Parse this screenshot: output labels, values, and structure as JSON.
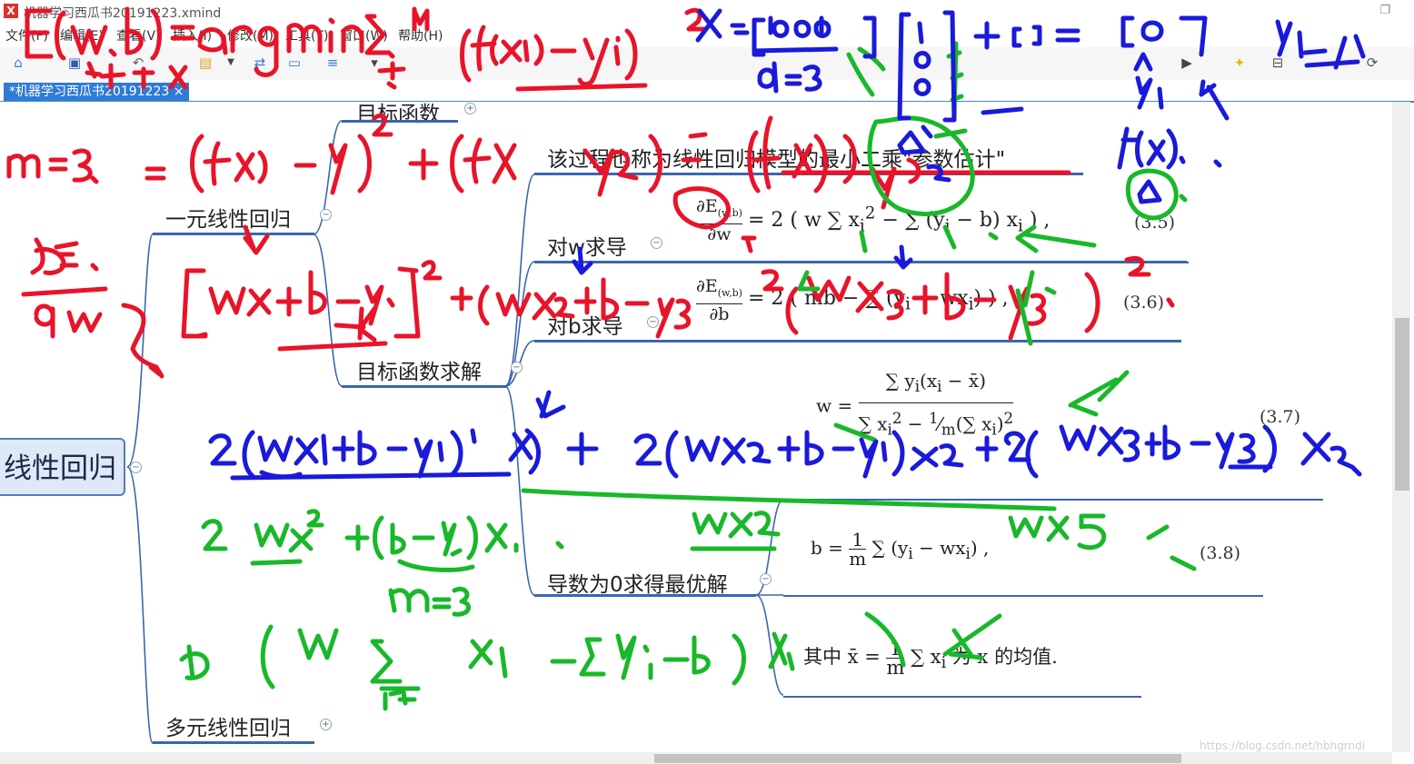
{
  "window": {
    "title": "机器学习西瓜书20191223.xmind",
    "app_icon": "X",
    "restore_glyph": "❐"
  },
  "menu": [
    "文件(F)",
    "编辑(E)",
    "查看(V)",
    "插入(I)",
    "修改(M)",
    "工具(T)",
    "窗口(W)",
    "帮助(H)"
  ],
  "toolbar_icons": [
    "home-icon",
    "save-icon",
    "undo-icon",
    "topic-icon",
    "dropdown-icon",
    "relationship-icon",
    "boundary-icon",
    "summary-icon",
    "marker-icon",
    "presentation-icon",
    "idea-icon",
    "export-icon",
    "share-icon"
  ],
  "tab": {
    "label": "*机器学习西瓜书20191223",
    "close": "×"
  },
  "mindmap": {
    "root": "线性回归",
    "branch_univariate": "一元线性回归",
    "branch_multivariate": "多元线性回归",
    "objective": "目标函数",
    "objective_solve": "目标函数求解",
    "lse_note": "该过程也称为线性回归模型的最小二乘\"参数估计\"",
    "deriv_w": "对w求导",
    "deriv_b": "对b求导",
    "optimal": "导数为0求得最优解",
    "mean_note_prefix": "其中",
    "mean_note_suffix": "为 x 的均值."
  },
  "equations": {
    "eq35": "(3.5)",
    "eq36": "(3.6)",
    "eq37": "(3.7)",
    "eq38": "(3.8)"
  },
  "watermark": "https://blog.csdn.net/hbhgrndi",
  "colors": {
    "accent": "#2f7bd6",
    "ink_red": "#e8142a",
    "ink_green": "#19b82a",
    "ink_blue": "#1a1adb",
    "node_line": "#3a66b0"
  }
}
